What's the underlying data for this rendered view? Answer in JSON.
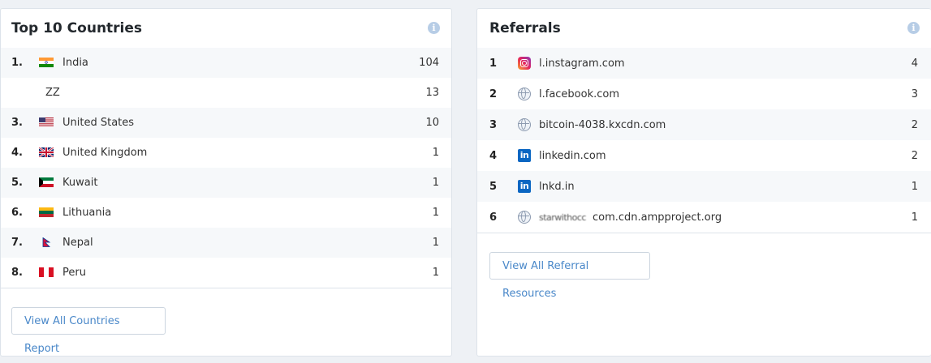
{
  "countries": {
    "title": "Top 10 Countries",
    "info_icon": "info-icon",
    "rows": [
      {
        "rank": "1.",
        "name": "India",
        "count": "104",
        "flag": "india-flag-icon"
      },
      {
        "rank": "",
        "name": "ZZ",
        "count": "13",
        "flag": ""
      },
      {
        "rank": "3.",
        "name": "United States",
        "count": "10",
        "flag": "usa-flag-icon"
      },
      {
        "rank": "4.",
        "name": "United Kingdom",
        "count": "1",
        "flag": "uk-flag-icon"
      },
      {
        "rank": "5.",
        "name": "Kuwait",
        "count": "1",
        "flag": "kuwait-flag-icon"
      },
      {
        "rank": "6.",
        "name": "Lithuania",
        "count": "1",
        "flag": "lithuania-flag-icon"
      },
      {
        "rank": "7.",
        "name": "Nepal",
        "count": "1",
        "flag": "nepal-flag-icon"
      },
      {
        "rank": "8.",
        "name": "Peru",
        "count": "1",
        "flag": "peru-flag-icon"
      }
    ],
    "button_label": "View All Countries Report"
  },
  "referrals": {
    "title": "Referrals",
    "info_icon": "info-icon",
    "rows": [
      {
        "rank": "1",
        "icon": "instagram-icon",
        "label": "l.instagram.com",
        "count": "4"
      },
      {
        "rank": "2",
        "icon": "globe-icon",
        "label": "l.facebook.com",
        "count": "3"
      },
      {
        "rank": "3",
        "icon": "globe-icon",
        "label": "bitcoin-4038.kxcdn.com",
        "count": "2"
      },
      {
        "rank": "4",
        "icon": "linkedin-icon",
        "label": "linkedin.com",
        "count": "2"
      },
      {
        "rank": "5",
        "icon": "linkedin-icon",
        "label": "lnkd.in",
        "count": "1"
      },
      {
        "rank": "6",
        "icon": "globe-icon",
        "label_prefix": "starwithocc",
        "label": "com.cdn.ampproject.org",
        "count": "1"
      }
    ],
    "button_label": "View All Referral Resources"
  },
  "colors": {
    "accent": "#4a88c9",
    "info": "#b7cde6",
    "linkedin": "#0a66c2"
  }
}
